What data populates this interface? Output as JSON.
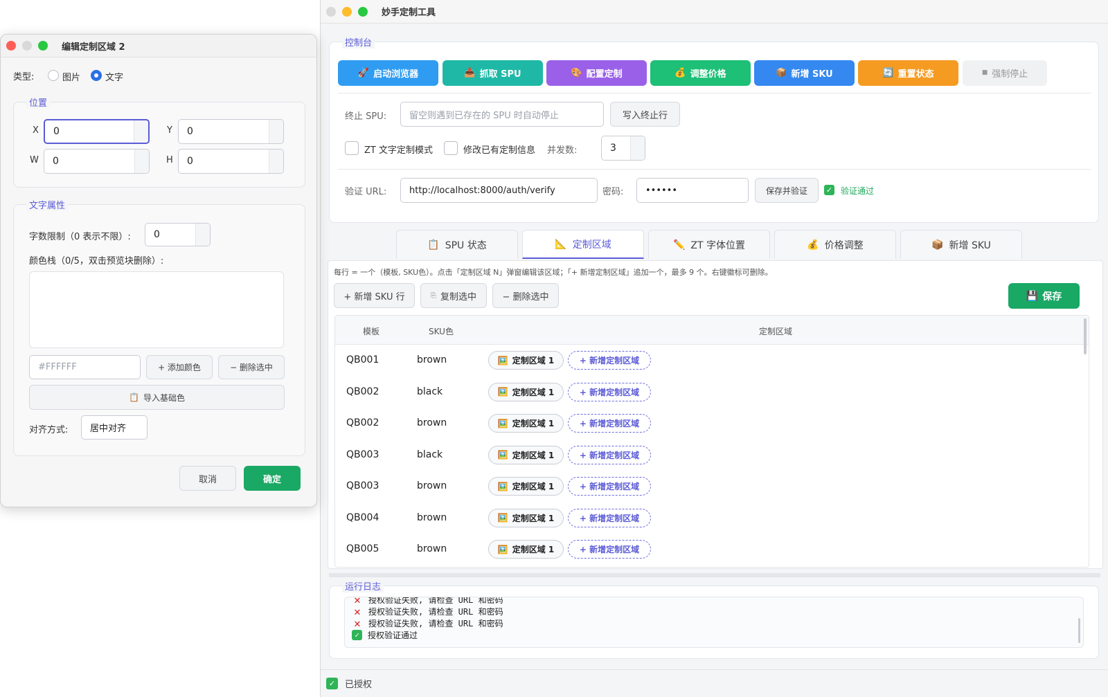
{
  "main": {
    "title": "妙手定制工具",
    "console_label": "控制台",
    "buttons": [
      {
        "label": "启动浏览器",
        "icon": "🚀",
        "color": "#2f9cf2"
      },
      {
        "label": "抓取 SPU",
        "icon": "📥",
        "color": "#1fb8a6"
      },
      {
        "label": "配置定制",
        "icon": "🎨",
        "color": "#9a61e8"
      },
      {
        "label": "调整价格",
        "icon": "💰",
        "color": "#1ebf76"
      },
      {
        "label": "新增 SKU",
        "icon": "📦",
        "color": "#3488f0"
      },
      {
        "label": "重置状态",
        "icon": "🔄",
        "color": "#f59b22"
      },
      {
        "label": "强制停止",
        "icon": "■",
        "color": "#f0f1f3"
      }
    ],
    "stop_spu_label": "终止 SPU:",
    "stop_spu_placeholder": "留空则遇到已存在的 SPU 时自动停止",
    "write_stop_button": "写入终止行",
    "zt_text_mode": "ZT 文字定制模式",
    "modify_existing": "修改已有定制信息",
    "concurrency_label": "并发数:",
    "concurrency_value": "3",
    "verify_url_label": "验证 URL:",
    "verify_url_value": "http://localhost:8000/auth/verify",
    "password_label": "密码:",
    "password_value": "••••••",
    "save_verify_button": "保存并验证",
    "verified_text": "验证通过",
    "tabs": [
      {
        "label": "SPU 状态",
        "icon": "📋"
      },
      {
        "label": "定制区域",
        "icon": "📐"
      },
      {
        "label": "ZT 字体位置",
        "icon": "✏️"
      },
      {
        "label": "价格调整",
        "icon": "💰"
      },
      {
        "label": "新增 SKU",
        "icon": "📦"
      }
    ],
    "hint": "每行 = 一个（模板, SKU色）。点击「定制区域 N」弹窗编辑该区域；「+ 新增定制区域」追加一个，最多 9 个。右键徽标可删除。",
    "add_sku_row": "+ 新增 SKU 行",
    "copy_selected": "复制选中",
    "delete_selected": "− 删除选中",
    "save_button": "保存",
    "table_headers": {
      "template": "模板",
      "sku_color": "SKU色",
      "region": "定制区域"
    },
    "rows": [
      {
        "template": "QB001",
        "color": "brown",
        "region": "定制区域 1",
        "add": "+ 新增定制区域"
      },
      {
        "template": "QB002",
        "color": "black",
        "region": "定制区域 1",
        "add": "+ 新增定制区域"
      },
      {
        "template": "QB002",
        "color": "brown",
        "region": "定制区域 1",
        "add": "+ 新增定制区域"
      },
      {
        "template": "QB003",
        "color": "black",
        "region": "定制区域 1",
        "add": "+ 新增定制区域"
      },
      {
        "template": "QB003",
        "color": "brown",
        "region": "定制区域 1",
        "add": "+ 新增定制区域"
      },
      {
        "template": "QB004",
        "color": "brown",
        "region": "定制区域 1",
        "add": "+ 新增定制区域"
      },
      {
        "template": "QB005",
        "color": "brown",
        "region": "定制区域 1",
        "add": "+ 新增定制区域"
      }
    ],
    "log_label": "运行日志",
    "log_lines": [
      {
        "type": "error",
        "text": "授权验证失败, 请检查 URL 和密码"
      },
      {
        "type": "error",
        "text": "授权验证失败, 请检查 URL 和密码"
      },
      {
        "type": "error",
        "text": "授权验证失败, 请检查 URL 和密码"
      },
      {
        "type": "ok",
        "text": "授权验证通过"
      }
    ],
    "status_text": "已授权"
  },
  "dialog": {
    "title": "编辑定制区域 2",
    "type_label": "类型:",
    "type_image": "图片",
    "type_text": "文字",
    "position_label": "位置",
    "x_label": "X",
    "x_value": "0",
    "y_label": "Y",
    "y_value": "0",
    "w_label": "W",
    "w_value": "0",
    "h_label": "H",
    "h_value": "0",
    "text_props_label": "文字属性",
    "char_limit_label": "字数限制（0 表示不限）:",
    "char_limit_value": "0",
    "color_stack_label": "颜色栈（0/5，双击预览块删除）:",
    "color_input_placeholder": "#FFFFFF",
    "add_color": "+ 添加颜色",
    "delete_selected": "− 删除选中",
    "import_base_colors": "导入基础色",
    "align_label": "对齐方式:",
    "align_value": "居中对齐",
    "cancel": "取消",
    "confirm": "确定"
  }
}
